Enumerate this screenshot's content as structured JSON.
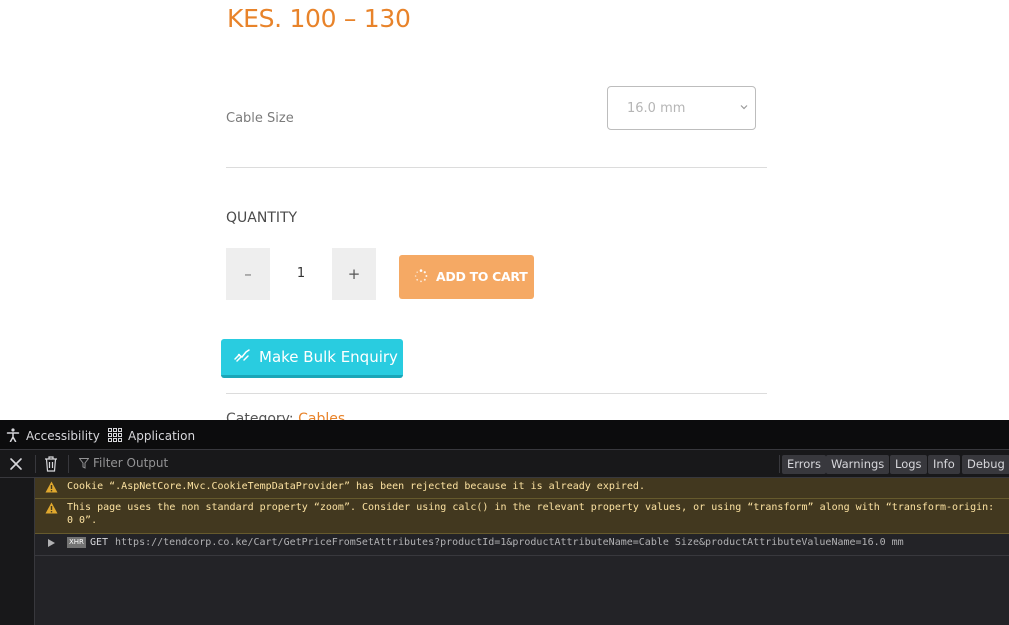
{
  "product": {
    "price_range": "KES. 100 – 130",
    "attribute_label": "Cable Size",
    "selected_size": "16.0 mm",
    "quantity_label": "QUANTITY",
    "quantity_value": "1",
    "minus_label": "–",
    "plus_label": "+",
    "add_to_cart_label": "ADD TO CART",
    "bulk_enquiry_label": "Make Bulk Enquiry",
    "category_label": "Category:",
    "category_value": "Cables",
    "accent_color": "#e8832a",
    "bulk_color": "#29cce0"
  },
  "devtools": {
    "tabs": [
      {
        "label": "Accessibility",
        "icon": "accessibility-icon"
      },
      {
        "label": "Application",
        "icon": "application-grid-icon"
      }
    ],
    "filter_placeholder": "Filter Output",
    "filter_buttons": [
      "Errors",
      "Warnings",
      "Logs",
      "Info",
      "Debug"
    ],
    "messages": [
      {
        "type": "warning",
        "text": "Cookie “.AspNetCore.Mvc.CookieTempDataProvider” has been rejected because it is already expired."
      },
      {
        "type": "warning",
        "text": "This page uses the non standard property “zoom”. Consider using calc() in the relevant property values, or using “transform” along with “transform-origin: 0 0”."
      },
      {
        "type": "network",
        "badge": "XHR",
        "method": "GET",
        "url": "https://tendcorp.co.ke/Cart/GetPriceFromSetAttributes?productId=1&productAttributeName=Cable Size&productAttributeValueName=16.0 mm"
      }
    ]
  }
}
